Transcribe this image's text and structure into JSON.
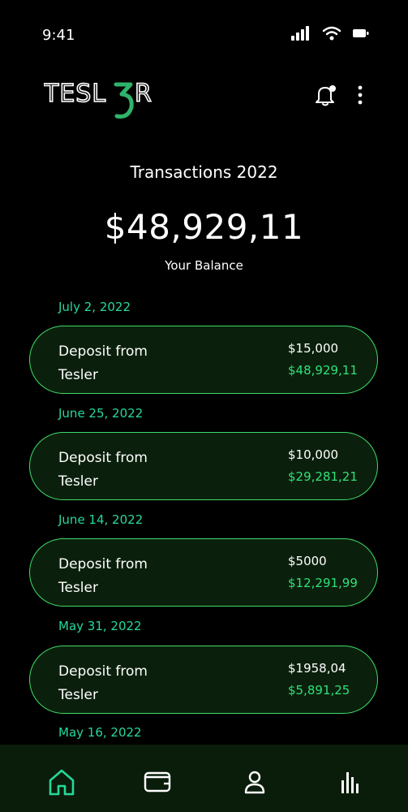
{
  "status_bar": {
    "time": "9:41"
  },
  "header": {
    "logo_text": "TESL3R"
  },
  "summary": {
    "title": "Transactions 2022",
    "balance": "$48,929,11",
    "balance_label": "Your Balance"
  },
  "transactions": [
    {
      "date": "July 2, 2022",
      "line1": "Deposit from",
      "line2": "Tesler",
      "amount": "$15,000",
      "balance": "$48,929,11"
    },
    {
      "date": "June 25, 2022",
      "line1": "Deposit from",
      "line2": "Tesler",
      "amount": "$10,000",
      "balance": "$29,281,21"
    },
    {
      "date": "June 14, 2022",
      "line1": "Deposit from",
      "line2": "Tesler",
      "amount": "$5000",
      "balance": "$12,291,99"
    },
    {
      "date": "May 31, 2022",
      "line1": "Deposit from",
      "line2": "Tesler",
      "amount": "$1958,04",
      "balance": "$5,891,25"
    },
    {
      "date": "May 16, 2022"
    }
  ],
  "nav": {
    "items": [
      "home-icon",
      "wallet-icon",
      "user-icon",
      "chart-icon"
    ],
    "active": "home-icon"
  },
  "colors": {
    "accent": "#25d99a",
    "card_border": "#3ddc6a",
    "card_bg": "#0b200c",
    "nav_bg": "#0a1d0a",
    "background": "#000000"
  }
}
